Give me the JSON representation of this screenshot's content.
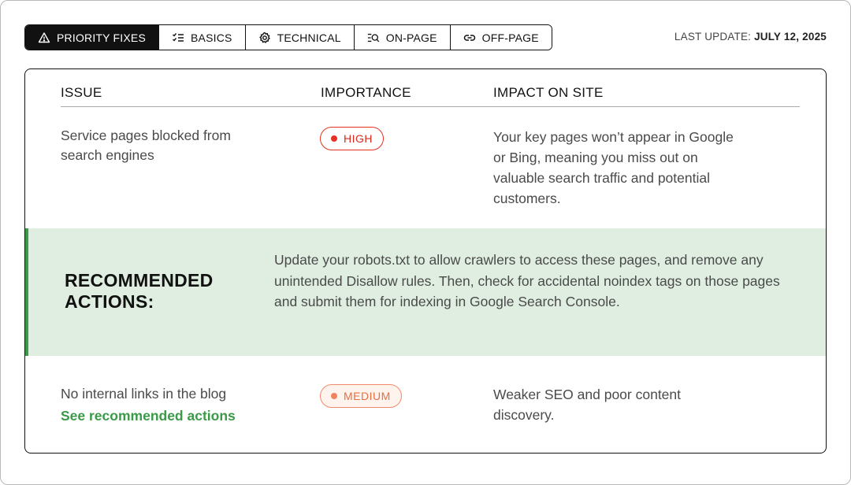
{
  "tabs": [
    {
      "label": "PRIORITY FIXES",
      "icon": "warning-icon",
      "active": true
    },
    {
      "label": "BASICS",
      "icon": "checklist-icon",
      "active": false
    },
    {
      "label": "TECHNICAL",
      "icon": "gear-icon",
      "active": false
    },
    {
      "label": "ON-PAGE",
      "icon": "search-list-icon",
      "active": false
    },
    {
      "label": "OFF-PAGE",
      "icon": "link-icon",
      "active": false
    }
  ],
  "last_update": {
    "label": "LAST UPDATE:",
    "date": "JULY 12, 2025"
  },
  "table": {
    "headers": {
      "issue": "ISSUE",
      "importance": "IMPORTANCE",
      "impact": "IMPACT ON SITE"
    },
    "rows": [
      {
        "issue": "Service pages blocked from search engines",
        "importance": "HIGH",
        "impact": "Your key pages won’t appear in Google or Bing, meaning you miss out on valuable search traffic and potential customers."
      },
      {
        "issue": "No internal links in the blog",
        "link": "See recommended actions",
        "importance": "MEDIUM",
        "impact": "Weaker SEO and poor content discovery."
      }
    ]
  },
  "recommended": {
    "title": "RECOMMENDED ACTIONS:",
    "body": "Update your robots.txt to allow crawlers to access these pages, and remove any unintended Disallow rules. Then, check for accidental noindex tags on those pages and submit them for indexing in Google Search Console."
  },
  "colors": {
    "high": "#e53222",
    "medium": "#f0825e",
    "accent_green": "#3a9a48",
    "rec_bg": "#dfeee0"
  }
}
